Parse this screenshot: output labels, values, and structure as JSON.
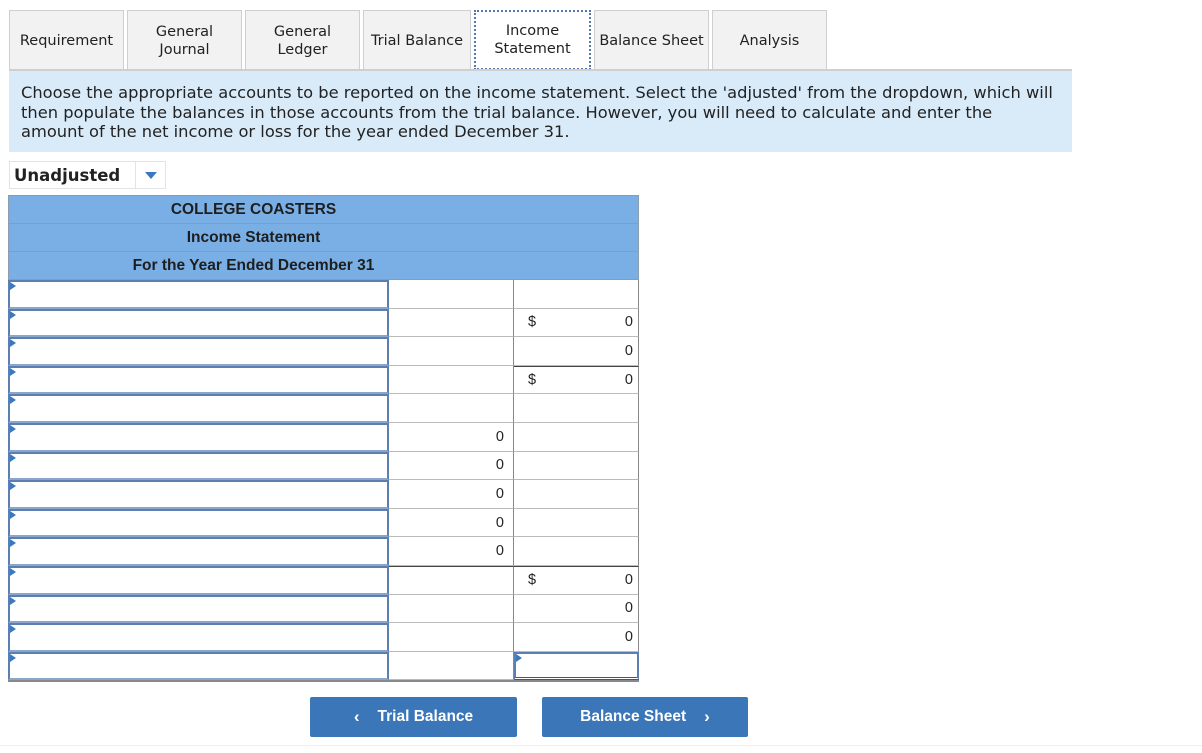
{
  "tabs": [
    {
      "label": "Requirement",
      "active": false
    },
    {
      "label": "General Journal",
      "active": false
    },
    {
      "label": "General Ledger",
      "active": false
    },
    {
      "label": "Trial Balance",
      "active": false
    },
    {
      "label": "Income Statement",
      "active": true
    },
    {
      "label": "Balance Sheet",
      "active": false
    },
    {
      "label": "Analysis",
      "active": false
    }
  ],
  "instructions": "Choose the appropriate accounts to be reported on the income statement. Select the 'adjusted' from the dropdown, which will then populate the balances in those accounts from the trial balance. However, you will need to calculate and enter the amount of the net income or loss for the year ended December 31.",
  "dropdown": {
    "selected": "Unadjusted"
  },
  "statement": {
    "company": "COLLEGE COASTERS",
    "title": "Income Statement",
    "period": "For the Year Ended December 31",
    "rows": [
      {
        "account": "",
        "mid": "",
        "right_dollar": "",
        "right": ""
      },
      {
        "account": "",
        "mid": "",
        "right_dollar": "$",
        "right": "0"
      },
      {
        "account": "",
        "mid": "",
        "right_dollar": "",
        "right": "0"
      },
      {
        "account": "",
        "mid": "",
        "right_dollar": "$",
        "right": "0"
      },
      {
        "account": "",
        "mid": "",
        "right_dollar": "",
        "right": ""
      },
      {
        "account": "",
        "mid": "0",
        "right_dollar": "",
        "right": ""
      },
      {
        "account": "",
        "mid": "0",
        "right_dollar": "",
        "right": ""
      },
      {
        "account": "",
        "mid": "0",
        "right_dollar": "",
        "right": ""
      },
      {
        "account": "",
        "mid": "0",
        "right_dollar": "",
        "right": ""
      },
      {
        "account": "",
        "mid": "0",
        "right_dollar": "",
        "right": ""
      },
      {
        "account": "",
        "mid": "",
        "right_dollar": "$",
        "right": "0"
      },
      {
        "account": "",
        "mid": "",
        "right_dollar": "",
        "right": "0"
      },
      {
        "account": "",
        "mid": "",
        "right_dollar": "",
        "right": "0"
      },
      {
        "account": "",
        "mid": "",
        "right_dollar": "",
        "right": ""
      }
    ]
  },
  "nav": {
    "prev_label": "Trial Balance",
    "prev_icon": "‹",
    "next_label": "Balance Sheet",
    "next_icon": "›"
  },
  "colors": {
    "tab_bg": "#f2f2f2",
    "instructions_bg": "#d9ebf9",
    "header_bg": "#7aafe6",
    "button_bg": "#3a76b8",
    "input_border": "#5a7fb0"
  }
}
